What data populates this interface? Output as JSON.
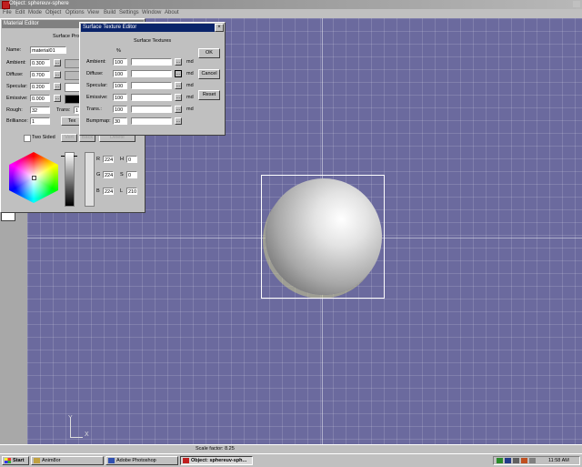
{
  "window": {
    "title": "Object: sphereuv-sphere"
  },
  "menu": [
    "File",
    "Edit",
    "Mode",
    "Object",
    "Options",
    "View",
    "Build",
    "Settings",
    "Window",
    "About"
  ],
  "material_editor": {
    "title": "Material Editor",
    "section_label": "Surface Prop",
    "name_label": "Name:",
    "name_value": "material01",
    "ambient_label": "Ambient:",
    "ambient_value": "0.300",
    "diffuse_label": "Diffuse:",
    "diffuse_value": "0.700",
    "specular_label": "Specular:",
    "specular_value": "0.200",
    "emissive_label": "Emissive:",
    "emissive_value": "0.000",
    "rough_label": "Rough:",
    "rough_value": "32",
    "trans_label": "Trans:",
    "trans_value": "1",
    "brilliance_label": "Brilliance:",
    "brilliance_value": "1",
    "tex_button": "Tex",
    "two_sided_label": "Two Sided",
    "vert_button": "Vert",
    "back_button": "Back",
    "delete_button": "Delete",
    "rgb": {
      "r_label": "R",
      "r": "224",
      "g_label": "G",
      "g": "224",
      "b_label": "B",
      "b": "224"
    },
    "hsl": {
      "h_label": "H",
      "h": "0",
      "s_label": "S",
      "s": "0",
      "l_label": "L",
      "l": "210"
    },
    "button_glyph": "...",
    "swatch_color": "#000000"
  },
  "surface_texture_editor": {
    "title": "Surface Texture Editor",
    "heading": "Surface Textures",
    "percent_header": "%",
    "rows": [
      {
        "label": "Ambient:",
        "percent": "100",
        "btn": "...",
        "md": "md"
      },
      {
        "label": "Diffuse:",
        "percent": "100",
        "btn": "...",
        "md": "md"
      },
      {
        "label": "Specular:",
        "percent": "100",
        "btn": "...",
        "md": "md"
      },
      {
        "label": "Emissive:",
        "percent": "100",
        "btn": "...",
        "md": "md"
      },
      {
        "label": "Trans.:",
        "percent": "100",
        "btn": "...",
        "md": "md"
      },
      {
        "label": "Bumpmap:",
        "percent": "30",
        "btn": "..."
      }
    ],
    "ok_button": "OK",
    "cancel_button": "Cancel",
    "reset_button": "Reset",
    "close_glyph": "×"
  },
  "viewport": {
    "axis_y": "Y",
    "axis_x": "X",
    "bg_color": "#6b6a9e"
  },
  "status": {
    "scale_text": "Scale factor: 8.25"
  },
  "taskbar": {
    "start": "Start",
    "items": [
      {
        "label": "Anim8or"
      },
      {
        "label": "Adobe Photoshop"
      },
      {
        "label": "Object: sphereuv-sph..."
      }
    ],
    "clock": "11:58 AM"
  }
}
